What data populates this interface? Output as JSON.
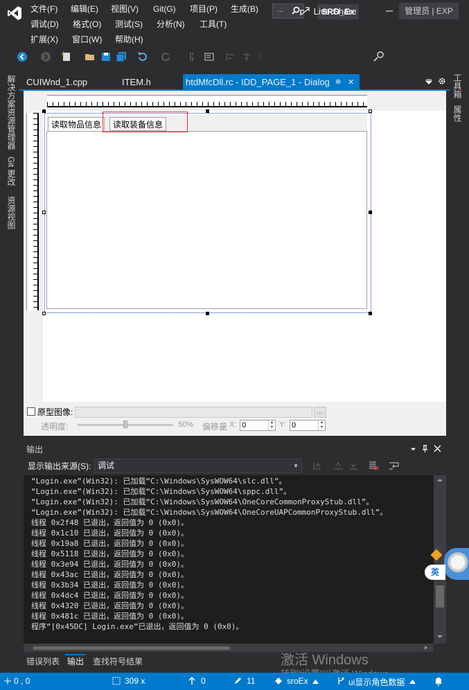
{
  "menu": {
    "row1": [
      "文件(F)",
      "编辑(E)",
      "视图(V)",
      "Git(G)",
      "项目(P)",
      "生成(B)"
    ],
    "row2": [
      "调试(D)",
      "格式(O)",
      "测试(S)",
      "分析(N)",
      "工具(T)"
    ],
    "row3": [
      "扩展(X)",
      "窗口(W)",
      "帮助(H)"
    ]
  },
  "search": {
    "dots": "..."
  },
  "solution_name": "SRO_Ex",
  "toolbar": {
    "liveshare_label": "Live Share",
    "admin_label": "管理员 | EXP"
  },
  "left_strip": {
    "tabs": [
      "解决方案资源管理器",
      "Git 更改",
      "资源视图"
    ]
  },
  "right_strip": {
    "tabs": [
      "工具箱",
      "属性"
    ]
  },
  "doc_tabs": {
    "tab1": "CUIWnd_1.cpp",
    "tab2": "ITEM.h",
    "active": "htdMfcDll.rc - IDD_PAGE_1 - Dialog",
    "pin": "⊕",
    "close": "✕"
  },
  "dialog": {
    "tab_items": [
      "读取物品信息",
      "读取装备信息"
    ]
  },
  "protobar": {
    "prototype_label": "原型图像:",
    "browse": "...",
    "opacity_label": "透明度:",
    "opacity_value": "50%",
    "offset_label": "偏移量",
    "x_label": "X:",
    "x_value": "0",
    "y_label": "Y:",
    "y_value": "0"
  },
  "output": {
    "title": "输出",
    "source_label": "显示输出来源(S):",
    "source_value": "调试",
    "lines": [
      "“Login.exe”(Win32): 已加载“C:\\Windows\\SysWOW64\\slc.dll”。",
      "“Login.exe”(Win32): 已加载“C:\\Windows\\SysWOW64\\sppc.dll”。",
      "“Login.exe”(Win32): 已加载“C:\\Windows\\SysWOW64\\OneCoreCommonProxyStub.dll”。",
      "“Login.exe”(Win32): 已加载“C:\\Windows\\SysWOW64\\OneCoreUAPCommonProxyStub.dll”。",
      "线程 0x2f48 已退出，返回值为 0 (0x0)。",
      "线程 0x1c10 已退出，返回值为 0 (0x0)。",
      "线程 0x19a8 已退出，返回值为 0 (0x0)。",
      "线程 0x5118 已退出，返回值为 0 (0x0)。",
      "线程 0x3e94 已退出，返回值为 0 (0x0)。",
      "线程 0x43ac 已退出，返回值为 0 (0x0)。",
      "线程 0x3b34 已退出，返回值为 0 (0x0)。",
      "线程 0x4dc4 已退出，返回值为 0 (0x0)。",
      "线程 0x4320 已退出，返回值为 0 (0x0)。",
      "线程 0x481c 已退出，返回值为 0 (0x0)。",
      "程序“[0x45DC] Login.exe”已退出，返回值为 0 (0x0)。"
    ]
  },
  "bottom_tabs": [
    "错误列表",
    "输出",
    "查找符号结果"
  ],
  "status": {
    "position": "0 , 0",
    "size": "309 x",
    "up_count": "0",
    "edit_count": "11",
    "repo": "sroEx",
    "branch": "ui显示角色数据"
  },
  "watermark": {
    "line1": "激活 Windows",
    "line2": "转到“设置”以激活 Windows。"
  },
  "ime": {
    "label": "英"
  },
  "colors": {
    "accent": "#007acc",
    "background": "#2d2d30",
    "output_bg": "#1e1e1e",
    "selection": "#e03030"
  }
}
